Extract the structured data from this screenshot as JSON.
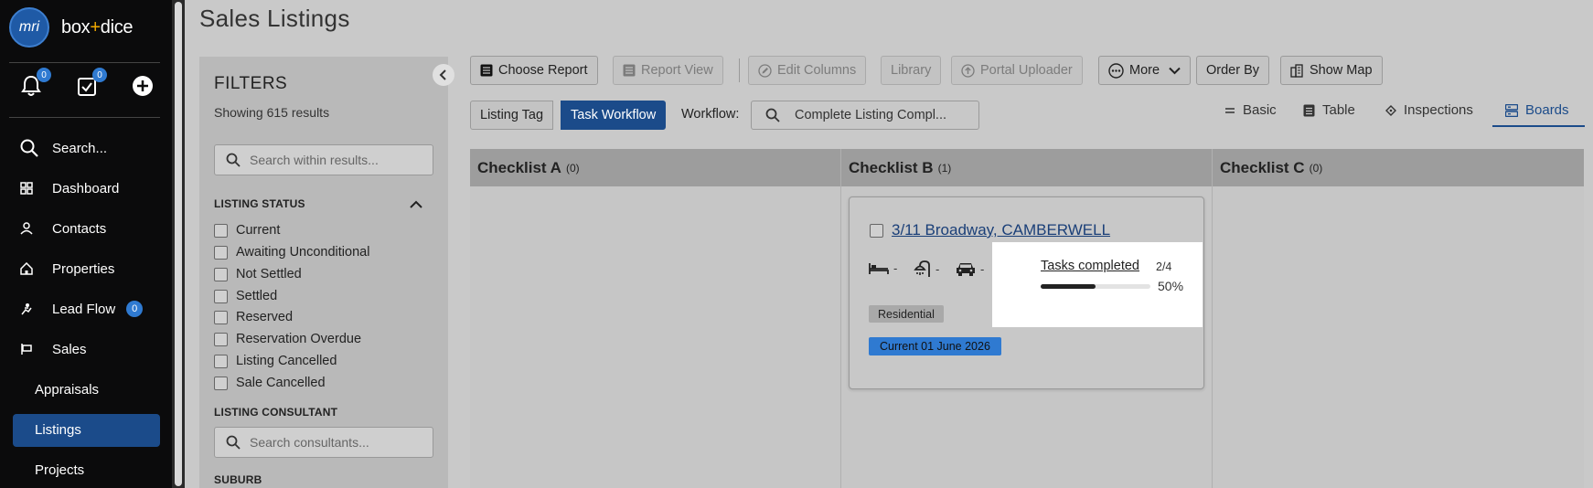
{
  "app": {
    "logo_mark": "mri",
    "logo_text_a": "box",
    "logo_plus": "+",
    "logo_text_b": "dice",
    "notifications_count": "0",
    "tasks_count": "0"
  },
  "nav": {
    "search": "Search...",
    "dashboard": "Dashboard",
    "contacts": "Contacts",
    "properties": "Properties",
    "lead_flow": "Lead Flow",
    "lead_flow_count": "0",
    "sales": "Sales",
    "appraisals": "Appraisals",
    "listings": "Listings",
    "projects": "Projects"
  },
  "page": {
    "title": "Sales Listings"
  },
  "filters": {
    "title": "FILTERS",
    "count_text": "Showing 615 results",
    "search_placeholder": "Search within results...",
    "listing_status_label": "LISTING STATUS",
    "statuses": [
      "Current",
      "Awaiting Unconditional",
      "Not Settled",
      "Settled",
      "Reserved",
      "Reservation Overdue",
      "Listing Cancelled",
      "Sale Cancelled"
    ],
    "consultant_label": "LISTING CONSULTANT",
    "consultant_placeholder": "Search consultants...",
    "suburb_label": "SUBURB"
  },
  "toolbar": {
    "choose_report": "Choose Report",
    "report_view": "Report View",
    "edit_columns": "Edit Columns",
    "library": "Library",
    "portal_uploader": "Portal Uploader",
    "more": "More",
    "order_by": "Order By",
    "show_map": "Show Map"
  },
  "workflow": {
    "seg_listing_tag": "Listing Tag",
    "seg_task_workflow": "Task Workflow",
    "label": "Workflow:",
    "selected": "Complete Listing Compl..."
  },
  "views": {
    "basic": "Basic",
    "table": "Table",
    "inspections": "Inspections",
    "boards": "Boards",
    "active": "Boards"
  },
  "board": {
    "columns": [
      {
        "title": "Checklist A",
        "count": "(0)"
      },
      {
        "title": "Checklist B",
        "count": "(1)"
      },
      {
        "title": "Checklist C",
        "count": "(0)"
      }
    ],
    "card": {
      "address": "3/11 Broadway, CAMBERWELL",
      "beds": "-",
      "baths": "-",
      "cars": "-",
      "category_tag": "Residential",
      "status_tag": "Current 01 June 2026",
      "tasks_label": "Tasks completed",
      "tasks_fraction": "2/4",
      "tasks_percent": "50%",
      "tasks_progress": 0.5
    }
  },
  "colors": {
    "accent": "#1b4b8a",
    "badge": "#2f7ad1",
    "nav_bg": "#0b0b0c"
  }
}
